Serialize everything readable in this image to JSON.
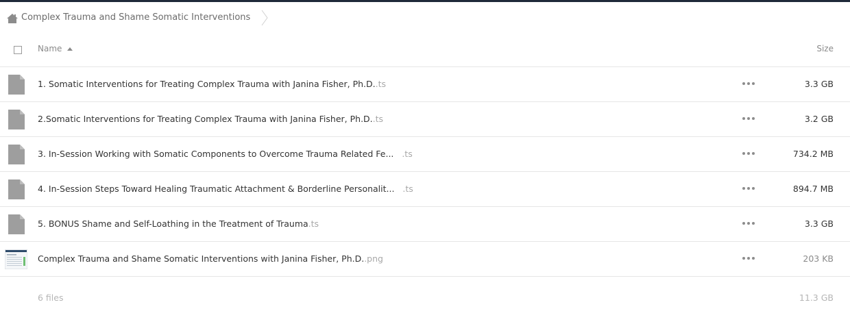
{
  "breadcrumb": {
    "folder": "Complex Trauma and Shame Somatic Interventions"
  },
  "header": {
    "name_label": "Name",
    "size_label": "Size"
  },
  "files": [
    {
      "name": "1. Somatic Interventions for Treating Complex Trauma with Janina Fisher, Ph.D.",
      "ext": ".ts",
      "size": "3.3 GB",
      "type": "file"
    },
    {
      "name": "2.Somatic Interventions for Treating Complex Trauma with Janina Fisher, Ph.D.",
      "ext": ".ts",
      "size": "3.2 GB",
      "type": "file"
    },
    {
      "name": "3. In-Session Working with Somatic Components to Overcome Trauma Related Fe...",
      "ext": ".ts",
      "size": "734.2 MB",
      "type": "file"
    },
    {
      "name": "4. In-Session Steps Toward Healing Traumatic Attachment & Borderline Personalit...",
      "ext": ".ts",
      "size": "894.7 MB",
      "type": "file"
    },
    {
      "name": "5. BONUS Shame and Self-Loathing in the Treatment of Trauma",
      "ext": ".ts",
      "size": "3.3 GB",
      "type": "file"
    },
    {
      "name": "Complex Trauma and Shame Somatic Interventions with Janina Fisher, Ph.D.",
      "ext": ".png",
      "size": "203 KB",
      "type": "image"
    }
  ],
  "footer": {
    "count": "6 files",
    "total": "11.3 GB"
  },
  "colors": {
    "topbar": "#1f2a3a",
    "file_icon": "#9e9e9e",
    "ext_text": "#a8a8a8"
  },
  "icons": {
    "home": "home-icon",
    "file": "file-icon",
    "image": "image-thumbnail-icon",
    "more": "more-options-icon"
  }
}
